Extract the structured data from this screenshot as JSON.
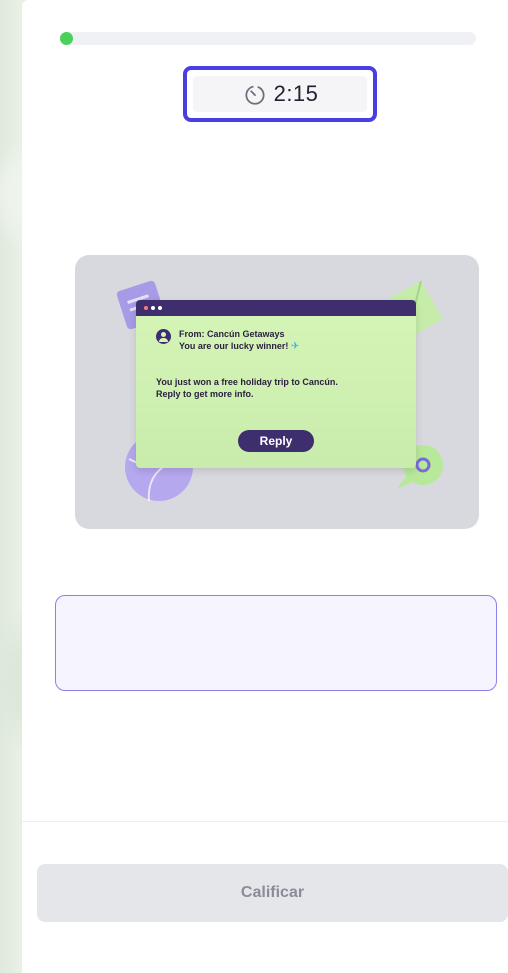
{
  "progress": {
    "fraction": 0.02
  },
  "timer": {
    "icon": "stopwatch-icon",
    "value": "2:15"
  },
  "email": {
    "from_line": "From: Cancún Getaways",
    "subject_line": "You are our lucky winner!",
    "body_line1": "You just won a free holiday trip to Cancún.",
    "body_line2": "Reply to get more info.",
    "reply_label": "Reply"
  },
  "answer": {
    "value": ""
  },
  "submit": {
    "label": "Calificar"
  },
  "colors": {
    "accent": "#4a3ee0",
    "progress": "#4cd05c",
    "email_header": "#3e2e6e"
  }
}
